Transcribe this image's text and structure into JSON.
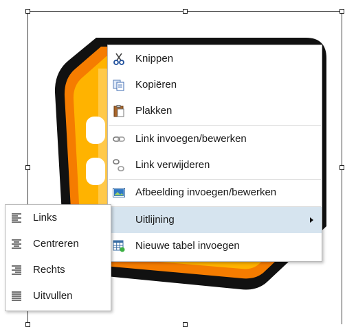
{
  "context_menu": {
    "items": [
      {
        "label": "Knippen",
        "icon": "scissors-icon"
      },
      {
        "label": "Kopiëren",
        "icon": "copy-icon"
      },
      {
        "label": "Plakken",
        "icon": "paste-icon"
      },
      {
        "label": "Link invoegen/bewerken",
        "icon": "link-icon"
      },
      {
        "label": "Link verwijderen",
        "icon": "unlink-icon"
      },
      {
        "label": "Afbeelding invoegen/bewerken",
        "icon": "image-icon"
      },
      {
        "label": "Uitlijning",
        "icon": "",
        "has_submenu": true,
        "highlighted": true
      },
      {
        "label": "Nieuwe tabel invoegen",
        "icon": "table-insert-icon"
      }
    ]
  },
  "alignment_submenu": {
    "items": [
      {
        "label": "Links",
        "icon": "align-left-icon"
      },
      {
        "label": "Centreren",
        "icon": "align-center-icon"
      },
      {
        "label": "Rechts",
        "icon": "align-right-icon"
      },
      {
        "label": "Uitvullen",
        "icon": "align-justify-icon"
      }
    ]
  },
  "colors": {
    "highlight": "#d6e4ef",
    "image_outline": "#111111",
    "image_orange": "#f57c00",
    "image_yellow": "#ffb300"
  }
}
